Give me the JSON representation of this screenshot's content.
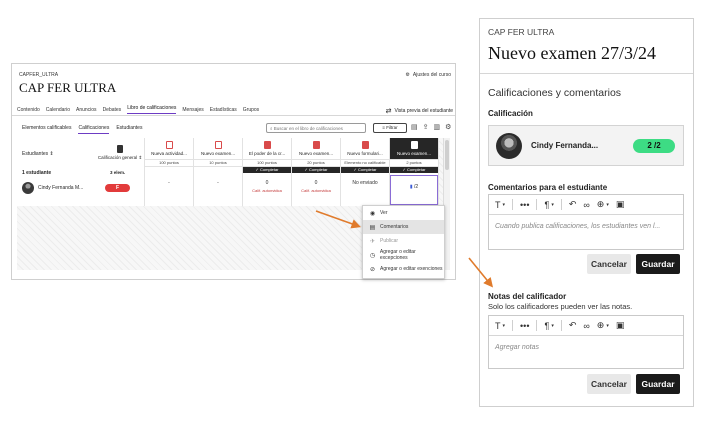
{
  "lms": {
    "course_id": "CAPFER_ULTRA",
    "course_title": "CAP FER ULTRA",
    "settings_label": "Ajustes del curso",
    "nav": [
      "Contenido",
      "Calendario",
      "Anuncios",
      "Debates",
      "Libro de calificaciones",
      "Mensajes",
      "Estadísticas",
      "Grupos"
    ],
    "nav_active_index": 4,
    "preview_label": "Vista previa del estudiante",
    "subtabs": [
      "Elementos calificables",
      "Calificaciones",
      "Estudiantes"
    ],
    "search_placeholder": "Buscar en el libro de calificaciones",
    "filter_label": "Filtrar",
    "students_header": "Estudiantes",
    "overall_header": "Calificación general",
    "students_count": "1 estudiante",
    "overall_points": "3 elem.",
    "student_name": "Cindy Fernanda M...",
    "overall_grade": "F",
    "columns": [
      {
        "title": "Nueva actividad...",
        "points": "100 puntos",
        "cell": "-",
        "auto": "",
        "badge": ""
      },
      {
        "title": "Nuevo examen...",
        "points": "10 puntos",
        "cell": "-",
        "auto": "",
        "badge": ""
      },
      {
        "title": "El poder de la cr...",
        "points": "100 puntos",
        "cell": "0",
        "auto": "Calif. automática",
        "badge": "Completar"
      },
      {
        "title": "Nuevo examen...",
        "points": "20 puntos",
        "cell": "0",
        "auto": "Calif. automática",
        "badge": "Completar"
      },
      {
        "title": "Nuevo formulari...",
        "points": "Elemento no calificable",
        "cell": "No enviado",
        "auto": "",
        "badge": "Completar"
      },
      {
        "title": "Nuevo examen...",
        "points": "2 puntos",
        "cell": "/2",
        "auto": "",
        "badge": "Completar"
      }
    ],
    "menu": [
      {
        "icon": "eye-icon",
        "glyph": "◉",
        "label": "Ver"
      },
      {
        "icon": "comment-icon",
        "glyph": "▤",
        "label": "Comentarios"
      },
      {
        "icon": "publish-icon",
        "glyph": "✈",
        "label": "Publicar"
      },
      {
        "icon": "clock-icon",
        "glyph": "◷",
        "label": "Agregar o editar excepciones"
      },
      {
        "icon": "block-icon",
        "glyph": "⊘",
        "label": "Agregar o editar exenciones"
      }
    ]
  },
  "panel": {
    "course_id": "CAP FER ULTRA",
    "title": "Nuevo examen 27/3/24",
    "section": "Calificaciones y comentarios",
    "grade_label": "Calificación",
    "student_name": "Cindy Fernanda...",
    "grade_value": "2 /2",
    "student_feedback_label": "Comentarios para el estudiante",
    "student_feedback_placeholder": "Cuando publica calificaciones, los estudiantes ven l...",
    "grader_notes_label": "Notas del calificador",
    "grader_notes_help": "Solo los calificadores pueden ver las notas.",
    "grader_notes_placeholder": "Agregar notas",
    "cancel_label": "Cancelar",
    "save_label": "Guardar"
  },
  "colors": {
    "accent": "#6d3cc4",
    "grade_pass": "#3ddc84",
    "grade_fail": "#e23b3b",
    "arrow": "#e07b2c"
  }
}
